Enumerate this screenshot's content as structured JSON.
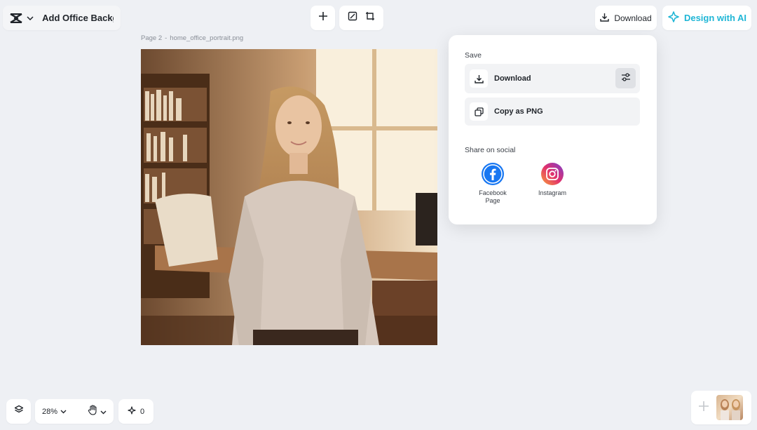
{
  "header": {
    "project_title": "Add Office Backgr...",
    "download_label": "Download",
    "design_ai_label": "Design with AI"
  },
  "canvas": {
    "page_label": "Page 2",
    "separator": "-",
    "file_name": "home_office_portrait.png"
  },
  "download_panel": {
    "save_title": "Save",
    "download_label": "Download",
    "copy_label": "Copy as PNG",
    "share_title": "Share on social",
    "social": [
      {
        "line1": "Facebook",
        "line2": "Page"
      },
      {
        "line1": "Instagram",
        "line2": ""
      }
    ]
  },
  "footer": {
    "zoom": "28%",
    "ai_count": "0"
  },
  "colors": {
    "accent": "#1fb6d6",
    "facebook": "#1877f2"
  }
}
